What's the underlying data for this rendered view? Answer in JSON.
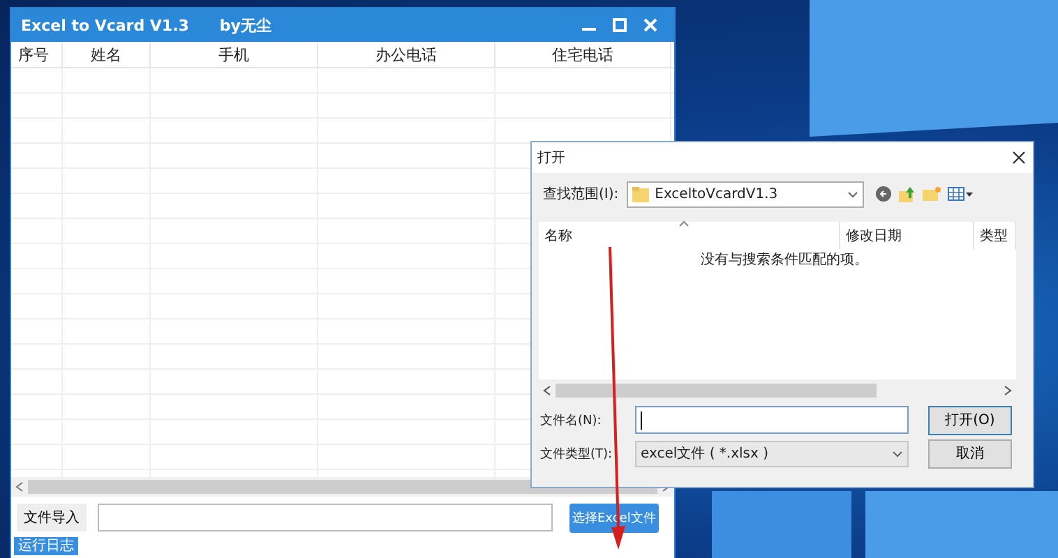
{
  "app_window": {
    "title": "Excel to Vcard V1.3",
    "author": "by无尘",
    "table": {
      "columns": [
        "序号",
        "姓名",
        "手机",
        "办公电话",
        "住宅电话"
      ]
    },
    "import_label": "文件导入",
    "select_button": "选择Excel文件",
    "log_tab": "运行日志"
  },
  "open_dialog": {
    "title": "打开",
    "look_in": {
      "label": "查找范围(I):",
      "value": "ExceltoVcardV1.3"
    },
    "file_list": {
      "columns": [
        "名称",
        "修改日期",
        "类型"
      ],
      "empty_message": "没有与搜索条件匹配的项。"
    },
    "file_name": {
      "label": "文件名(N):"
    },
    "file_type": {
      "label": "文件类型(T):",
      "value": "excel文件 ( *.xlsx )"
    },
    "buttons": [
      "打开(O)",
      "取消"
    ]
  }
}
